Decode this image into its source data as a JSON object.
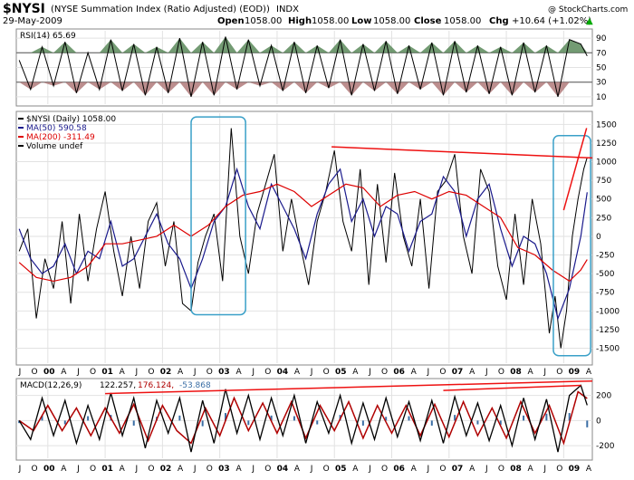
{
  "header": {
    "symbol": "$NYSI",
    "description": "(NYSE Summation Index (Ratio Adjusted) (EOD))",
    "exchange": "INDX",
    "date": "29-May-2009",
    "watermark": "@ StockCharts.com",
    "open_label": "Open",
    "open_value": "1058.00",
    "high_label": "High",
    "high_value": "1058.00",
    "low_label": "Low",
    "low_value": "1058.00",
    "close_label": "Close",
    "close_value": "1058.00",
    "chg_label": "Chg",
    "chg_value": "+10.64 (+1.02%)",
    "up_arrow": "▲"
  },
  "colors": {
    "price": "#000000",
    "ma50": "#1a1a8c",
    "ma200": "#dd0000",
    "rsi_fill": "#5a8a5a",
    "rsi_fill_low": "#b07a7a",
    "annotation_box": "#3aa0c8",
    "annotation_line": "#ee1111",
    "macd_hist": "#3a6ea5",
    "macd_signal": "#b00000",
    "grid": "#e2e2e2",
    "chg_up": "#00aa00"
  },
  "chart_data": [
    {
      "type": "line",
      "panel": "rsi",
      "title": "RSI(14) 65.69",
      "ylim": [
        0,
        100
      ],
      "yticks": [
        10,
        30,
        50,
        70,
        90
      ],
      "reference_levels": [
        30,
        70
      ],
      "fill_above": 70,
      "fill_below": 30,
      "grid": true,
      "legend": "top-left",
      "series": [
        {
          "name": "RSI(14)",
          "x": [
            1999.5,
            1999.7,
            1999.9,
            2000.1,
            2000.3,
            2000.5,
            2000.7,
            2000.9,
            2001.1,
            2001.3,
            2001.5,
            2001.7,
            2001.9,
            2002.1,
            2002.3,
            2002.5,
            2002.7,
            2002.9,
            2003.1,
            2003.3,
            2003.5,
            2003.7,
            2003.9,
            2004.1,
            2004.3,
            2004.5,
            2004.7,
            2004.9,
            2005.1,
            2005.3,
            2005.5,
            2005.7,
            2005.9,
            2006.1,
            2006.3,
            2006.5,
            2006.7,
            2006.9,
            2007.1,
            2007.3,
            2007.5,
            2007.7,
            2007.9,
            2008.1,
            2008.3,
            2008.5,
            2008.7,
            2008.9,
            2009.1,
            2009.3,
            2009.41
          ],
          "values": [
            60,
            20,
            78,
            25,
            85,
            15,
            70,
            20,
            88,
            18,
            82,
            12,
            78,
            15,
            90,
            10,
            85,
            12,
            92,
            20,
            88,
            25,
            80,
            18,
            85,
            15,
            80,
            22,
            88,
            12,
            82,
            18,
            86,
            14,
            80,
            20,
            84,
            12,
            86,
            16,
            80,
            14,
            78,
            12,
            84,
            16,
            80,
            10,
            88,
            82,
            65.69
          ]
        }
      ]
    },
    {
      "type": "line",
      "panel": "price",
      "title": "$NYSI (Daily) 1058.00",
      "ylim": [
        -1700,
        1650
      ],
      "yticks": [
        -1500,
        -1250,
        -1000,
        -750,
        -500,
        -250,
        0,
        250,
        500,
        750,
        1000,
        1250,
        1500
      ],
      "xlim": [
        1999.45,
        2009.5
      ],
      "xtick_labels": [
        "J",
        "O",
        "00",
        "A",
        "J",
        "O",
        "01",
        "A",
        "J",
        "O",
        "02",
        "A",
        "J",
        "O",
        "03",
        "A",
        "J",
        "O",
        "04",
        "A",
        "J",
        "O",
        "05",
        "A",
        "J",
        "O",
        "06",
        "A",
        "J",
        "O",
        "07",
        "A",
        "J",
        "O",
        "08",
        "A",
        "J",
        "O",
        "09",
        "A"
      ],
      "grid": true,
      "legend": "top-left",
      "series": [
        {
          "name": "$NYSI (Daily) 1058.00",
          "x": [
            1999.5,
            1999.65,
            1999.8,
            1999.95,
            2000.1,
            2000.25,
            2000.4,
            2000.55,
            2000.7,
            2000.85,
            2001.0,
            2001.15,
            2001.3,
            2001.45,
            2001.6,
            2001.75,
            2001.9,
            2002.05,
            2002.2,
            2002.35,
            2002.5,
            2002.62,
            2002.75,
            2002.9,
            2003.05,
            2003.2,
            2003.35,
            2003.5,
            2003.65,
            2003.8,
            2003.95,
            2004.1,
            2004.25,
            2004.4,
            2004.55,
            2004.7,
            2004.85,
            2005.0,
            2005.15,
            2005.3,
            2005.45,
            2005.6,
            2005.75,
            2005.9,
            2006.05,
            2006.2,
            2006.35,
            2006.5,
            2006.65,
            2006.8,
            2006.95,
            2007.1,
            2007.25,
            2007.4,
            2007.55,
            2007.7,
            2007.85,
            2008.0,
            2008.15,
            2008.3,
            2008.45,
            2008.6,
            2008.75,
            2008.85,
            2008.95,
            2009.05,
            2009.15,
            2009.25,
            2009.35,
            2009.41
          ],
          "values": [
            -200,
            100,
            -1100,
            -300,
            -700,
            200,
            -900,
            300,
            -600,
            100,
            600,
            -200,
            -800,
            0,
            -700,
            200,
            450,
            -400,
            200,
            -900,
            -1000,
            -350,
            0,
            300,
            -600,
            1450,
            0,
            -500,
            300,
            700,
            1100,
            -200,
            500,
            -100,
            -650,
            200,
            600,
            1150,
            200,
            -200,
            900,
            -650,
            700,
            -350,
            850,
            0,
            -400,
            500,
            -700,
            600,
            750,
            1100,
            0,
            -500,
            900,
            600,
            -400,
            -850,
            300,
            -650,
            500,
            -100,
            -1300,
            -800,
            -1500,
            -1000,
            0,
            500,
            900,
            1058
          ]
        },
        {
          "name": "MA(50) 590.58",
          "x": [
            1999.5,
            1999.7,
            1999.9,
            2000.1,
            2000.3,
            2000.5,
            2000.7,
            2000.9,
            2001.1,
            2001.3,
            2001.5,
            2001.7,
            2001.9,
            2002.1,
            2002.3,
            2002.5,
            2002.7,
            2002.9,
            2003.1,
            2003.3,
            2003.5,
            2003.7,
            2003.9,
            2004.1,
            2004.3,
            2004.5,
            2004.7,
            2004.9,
            2005.1,
            2005.3,
            2005.5,
            2005.7,
            2005.9,
            2006.1,
            2006.3,
            2006.5,
            2006.7,
            2006.9,
            2007.1,
            2007.3,
            2007.5,
            2007.7,
            2007.9,
            2008.1,
            2008.3,
            2008.5,
            2008.7,
            2008.9,
            2009.1,
            2009.3,
            2009.41
          ],
          "values": [
            100,
            -300,
            -500,
            -400,
            -100,
            -500,
            -200,
            -300,
            200,
            -400,
            -300,
            0,
            300,
            -100,
            -300,
            -700,
            -300,
            200,
            400,
            900,
            400,
            100,
            700,
            400,
            100,
            -300,
            300,
            700,
            900,
            200,
            500,
            0,
            400,
            300,
            -200,
            200,
            300,
            800,
            600,
            0,
            500,
            700,
            100,
            -400,
            0,
            -100,
            -500,
            -1100,
            -700,
            0,
            590.58
          ]
        },
        {
          "name": "MA(200) -311.49",
          "x": [
            1999.5,
            1999.8,
            2000.1,
            2000.4,
            2000.7,
            2001.0,
            2001.3,
            2001.6,
            2001.9,
            2002.2,
            2002.5,
            2002.8,
            2003.1,
            2003.4,
            2003.7,
            2004.0,
            2004.3,
            2004.6,
            2004.9,
            2005.2,
            2005.5,
            2005.8,
            2006.1,
            2006.4,
            2006.7,
            2007.0,
            2007.3,
            2007.6,
            2007.9,
            2008.2,
            2008.5,
            2008.8,
            2009.1,
            2009.3,
            2009.41
          ],
          "values": [
            -350,
            -550,
            -600,
            -550,
            -400,
            -100,
            -100,
            -50,
            0,
            150,
            0,
            150,
            400,
            550,
            600,
            700,
            600,
            400,
            550,
            700,
            650,
            400,
            550,
            600,
            500,
            600,
            550,
            400,
            250,
            -150,
            -250,
            -450,
            -600,
            -450,
            -311.49
          ]
        }
      ],
      "annotations": {
        "boxes": [
          "2002 bottom",
          "2009 bottom"
        ],
        "trendlines": [
          "falling resistance 2003–2009",
          "steep rise 2009"
        ]
      }
    },
    {
      "type": "line",
      "panel": "macd",
      "title": "MACD(12,26,9)",
      "values_label": {
        "macd": "122.257",
        "signal": "176.124",
        "histogram": "-53.868"
      },
      "ylim": [
        -300,
        320
      ],
      "yticks": [
        -200,
        0,
        200
      ],
      "xtick_labels": [
        "J",
        "O",
        "00",
        "A",
        "J",
        "O",
        "01",
        "A",
        "J",
        "O",
        "02",
        "A",
        "J",
        "O",
        "03",
        "A",
        "J",
        "O",
        "04",
        "A",
        "J",
        "O",
        "05",
        "A",
        "J",
        "O",
        "06",
        "A",
        "J",
        "O",
        "07",
        "A",
        "J",
        "O",
        "08",
        "A",
        "J",
        "O",
        "09",
        "A"
      ],
      "grid": true,
      "legend": "top-left",
      "series": [
        {
          "name": "MACD 122.257",
          "x": [
            1999.5,
            1999.7,
            1999.9,
            2000.1,
            2000.3,
            2000.5,
            2000.7,
            2000.9,
            2001.1,
            2001.3,
            2001.5,
            2001.7,
            2001.9,
            2002.1,
            2002.3,
            2002.5,
            2002.7,
            2002.9,
            2003.1,
            2003.3,
            2003.5,
            2003.7,
            2003.9,
            2004.1,
            2004.3,
            2004.5,
            2004.7,
            2004.9,
            2005.1,
            2005.3,
            2005.5,
            2005.7,
            2005.9,
            2006.1,
            2006.3,
            2006.5,
            2006.7,
            2006.9,
            2007.1,
            2007.3,
            2007.5,
            2007.7,
            2007.9,
            2008.1,
            2008.3,
            2008.5,
            2008.7,
            2008.9,
            2009.1,
            2009.3,
            2009.41
          ],
          "values": [
            0,
            -150,
            180,
            -120,
            160,
            -180,
            120,
            -150,
            220,
            -120,
            180,
            -220,
            160,
            -100,
            180,
            -250,
            160,
            -180,
            250,
            -100,
            200,
            -150,
            180,
            -120,
            200,
            -180,
            150,
            -100,
            200,
            -180,
            140,
            -150,
            180,
            -130,
            150,
            -160,
            160,
            -180,
            190,
            -120,
            140,
            -160,
            120,
            -200,
            180,
            -150,
            170,
            -250,
            200,
            280,
            122.257
          ]
        },
        {
          "name": "Signal 176.124",
          "x": [
            1999.5,
            1999.75,
            2000.0,
            2000.25,
            2000.5,
            2000.75,
            2001.0,
            2001.25,
            2001.5,
            2001.75,
            2002.0,
            2002.25,
            2002.5,
            2002.75,
            2003.0,
            2003.25,
            2003.5,
            2003.75,
            2004.0,
            2004.25,
            2004.5,
            2004.75,
            2005.0,
            2005.25,
            2005.5,
            2005.75,
            2006.0,
            2006.25,
            2006.5,
            2006.75,
            2007.0,
            2007.25,
            2007.5,
            2007.75,
            2008.0,
            2008.25,
            2008.5,
            2008.75,
            2009.0,
            2009.25,
            2009.41
          ],
          "values": [
            0,
            -80,
            120,
            -80,
            100,
            -120,
            100,
            -100,
            130,
            -160,
            120,
            -80,
            -180,
            100,
            -120,
            180,
            -80,
            140,
            -100,
            150,
            -140,
            120,
            -80,
            150,
            -140,
            120,
            -100,
            120,
            -120,
            130,
            -130,
            150,
            -120,
            100,
            -140,
            150,
            -100,
            120,
            -180,
            230,
            176.124
          ]
        },
        {
          "name": "Histogram -53.868",
          "x": [
            1999.5,
            1999.9,
            2000.3,
            2000.7,
            2001.1,
            2001.5,
            2001.9,
            2002.3,
            2002.7,
            2003.1,
            2003.5,
            2003.9,
            2004.3,
            2004.7,
            2005.1,
            2005.5,
            2005.9,
            2006.3,
            2006.7,
            2007.1,
            2007.5,
            2007.9,
            2008.3,
            2008.7,
            2009.1,
            2009.41
          ],
          "values": [
            -20,
            40,
            -30,
            35,
            45,
            -40,
            30,
            40,
            -45,
            60,
            -35,
            40,
            35,
            -30,
            45,
            -40,
            30,
            35,
            -40,
            45,
            -30,
            -35,
            40,
            55,
            60,
            -53.868
          ]
        }
      ]
    }
  ]
}
